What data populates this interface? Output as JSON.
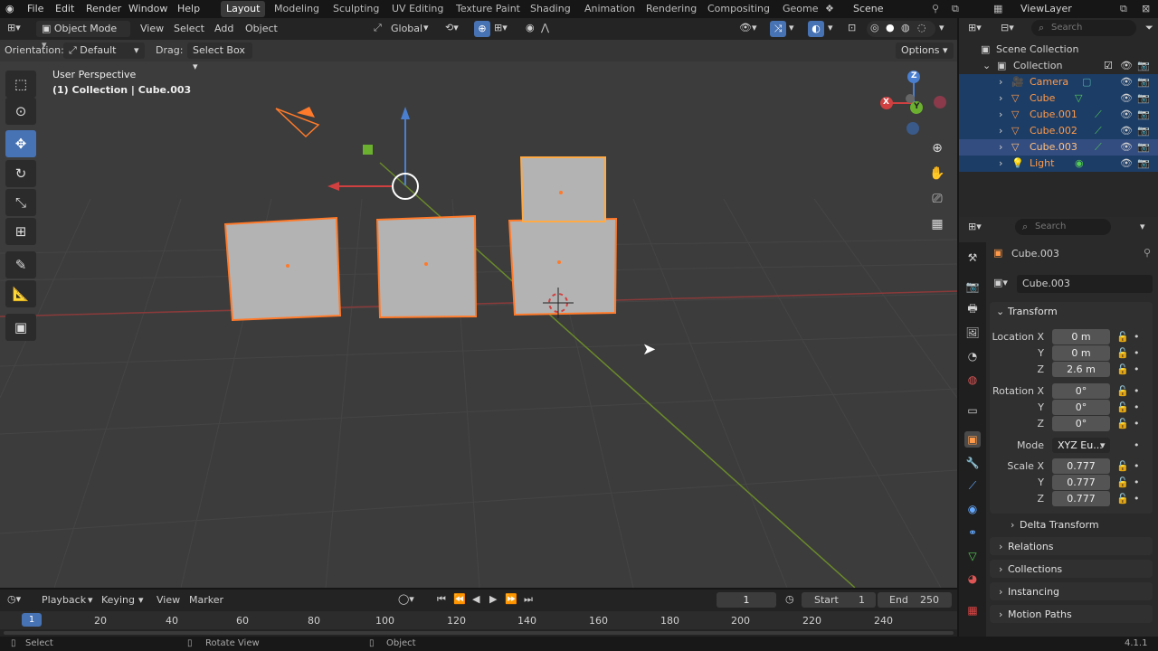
{
  "top_menu": {
    "file": "File",
    "edit": "Edit",
    "render": "Render",
    "window": "Window",
    "help": "Help"
  },
  "workspaces": [
    "Layout",
    "Modeling",
    "Sculpting",
    "UV Editing",
    "Texture Paint",
    "Shading",
    "Animation",
    "Rendering",
    "Compositing",
    "Geome"
  ],
  "scene": "Scene",
  "view_layer": "ViewLayer",
  "header": {
    "mode": "Object Mode",
    "view": "View",
    "select": "Select",
    "add": "Add",
    "object": "Object",
    "orientation_global": "Global"
  },
  "options_bar": {
    "orientation_label": "Orientation:",
    "orientation_value": "Default",
    "drag_label": "Drag:",
    "drag_value": "Select Box",
    "options": "Options"
  },
  "viewport": {
    "perspective": "User Perspective",
    "context": "(1) Collection | Cube.003",
    "gizmo_x": "X",
    "gizmo_y": "Y",
    "gizmo_z": "Z"
  },
  "outliner": {
    "search_placeholder": "Search",
    "scene_collection": "Scene Collection",
    "collection": "Collection",
    "items": [
      {
        "name": "Camera"
      },
      {
        "name": "Cube"
      },
      {
        "name": "Cube.001"
      },
      {
        "name": "Cube.002"
      },
      {
        "name": "Cube.003"
      },
      {
        "name": "Light"
      }
    ]
  },
  "properties": {
    "search_placeholder": "Search",
    "object_name": "Cube.003",
    "object_field": "Cube.003",
    "transform": "Transform",
    "location_label": "Location X",
    "rotation_label": "Rotation X",
    "mode_label": "Mode",
    "scale_label": "Scale X",
    "y": "Y",
    "z": "Z",
    "location": [
      "0 m",
      "0 m",
      "2.6 m"
    ],
    "rotation": [
      "0°",
      "0°",
      "0°"
    ],
    "mode": "XYZ Eu...",
    "scale": [
      "0.777",
      "0.777",
      "0.777"
    ],
    "delta_transform": "Delta Transform",
    "relations": "Relations",
    "collections": "Collections",
    "instancing": "Instancing",
    "motion_paths": "Motion Paths"
  },
  "timeline": {
    "playback": "Playback",
    "keying": "Keying",
    "view": "View",
    "marker": "Marker",
    "current_frame": "1",
    "start_label": "Start",
    "start": "1",
    "end_label": "End",
    "end": "250",
    "ruler": [
      "1",
      "20",
      "40",
      "60",
      "80",
      "100",
      "120",
      "140",
      "160",
      "180",
      "200",
      "220",
      "240"
    ]
  },
  "status_bar": {
    "select": "Select",
    "rotate_view": "Rotate View",
    "object": "Object",
    "version": "4.1.1"
  },
  "colors": {
    "accent": "#4772b3",
    "selection_outline": "#ff7a2a",
    "active_row": "#334d80",
    "x_axis": "#b0303a",
    "y_axis": "#6a9a2a"
  }
}
